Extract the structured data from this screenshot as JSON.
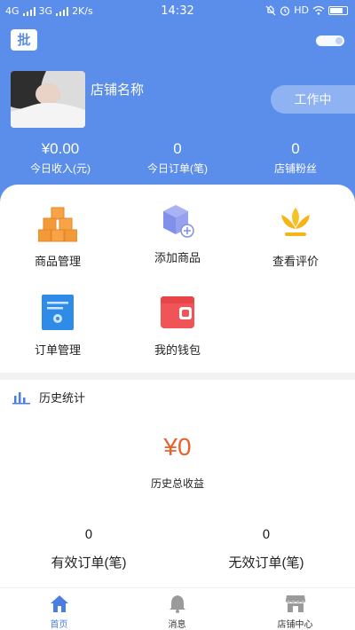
{
  "status_bar": {
    "network1": "4G",
    "network2": "3G",
    "speed": "2K/s",
    "time": "14:32",
    "hd": "HD"
  },
  "header": {
    "badge_text": "批",
    "store_name": "店铺名称",
    "status_button": "工作中",
    "accent_color": "#5b8dea"
  },
  "stats": [
    {
      "value": "¥0.00",
      "label": "今日收入(元)"
    },
    {
      "value": "0",
      "label": "今日订单(笔)"
    },
    {
      "value": "0",
      "label": "店铺粉丝"
    }
  ],
  "menu": [
    {
      "label": "商品管理",
      "icon": "cubes-icon"
    },
    {
      "label": "添加商品",
      "icon": "add-box-icon"
    },
    {
      "label": "查看评价",
      "icon": "flower-icon"
    },
    {
      "label": "订单管理",
      "icon": "order-doc-icon"
    },
    {
      "label": "我的钱包",
      "icon": "wallet-icon"
    }
  ],
  "history": {
    "title": "历史统计",
    "total_value": "¥0",
    "total_label": "历史总收益",
    "valid_orders_value": "0",
    "valid_orders_label": "有效订单(笔)",
    "invalid_orders_value": "0",
    "invalid_orders_label": "无效订单(笔)",
    "highlight_color": "#e8622c"
  },
  "bottom_nav": [
    {
      "label": "首页",
      "icon": "home-icon",
      "active": true
    },
    {
      "label": "消息",
      "icon": "bell-icon",
      "active": false
    },
    {
      "label": "店铺中心",
      "icon": "store-icon",
      "active": false
    }
  ]
}
